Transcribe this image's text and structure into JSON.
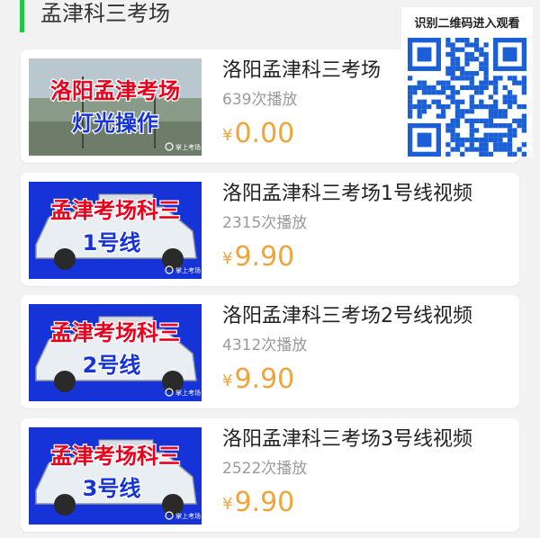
{
  "section": {
    "title": "孟津科三考场"
  },
  "colors": {
    "accent_green": "#27c24c",
    "price": "#f2a33a",
    "qr": "#1a5fd6",
    "thumb_red": "#e8001c",
    "thumb_blue": "#1633d8"
  },
  "qr": {
    "caption": "识别二维码进入观看",
    "icon": "qr-code-icon"
  },
  "items": [
    {
      "title": "洛阳孟津科三考场",
      "plays": "639次播放",
      "currency": "¥",
      "price": "0.00",
      "thumb": {
        "line1": "洛阳孟津考场",
        "line2": "灯光操作",
        "watermark": "掌上考场"
      }
    },
    {
      "title": "洛阳孟津科三考场1号线视频",
      "plays": "2315次播放",
      "currency": "¥",
      "price": "9.90",
      "thumb": {
        "line1": "孟津考场科三",
        "line2": "1号线",
        "watermark": "掌上考场"
      }
    },
    {
      "title": "洛阳孟津科三考场2号线视频",
      "plays": "4312次播放",
      "currency": "¥",
      "price": "9.90",
      "thumb": {
        "line1": "孟津考场科三",
        "line2": "2号线",
        "watermark": "掌上考场"
      }
    },
    {
      "title": "洛阳孟津科三考场3号线视频",
      "plays": "2522次播放",
      "currency": "¥",
      "price": "9.90",
      "thumb": {
        "line1": "孟津考场科三",
        "line2": "3号线",
        "watermark": "掌上考场"
      }
    }
  ]
}
